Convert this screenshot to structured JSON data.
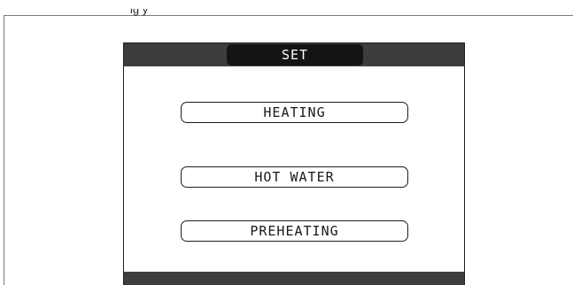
{
  "caption": {
    "partial_text": "ig y"
  },
  "screen": {
    "title": "SET",
    "menu": [
      {
        "label": "HEATING"
      },
      {
        "label": "HOT WATER"
      },
      {
        "label": "PREHEATING"
      }
    ]
  },
  "colors": {
    "header_bar": "#3d3d3d",
    "title_pill": "#141414",
    "outline": "#1c1c1c"
  }
}
